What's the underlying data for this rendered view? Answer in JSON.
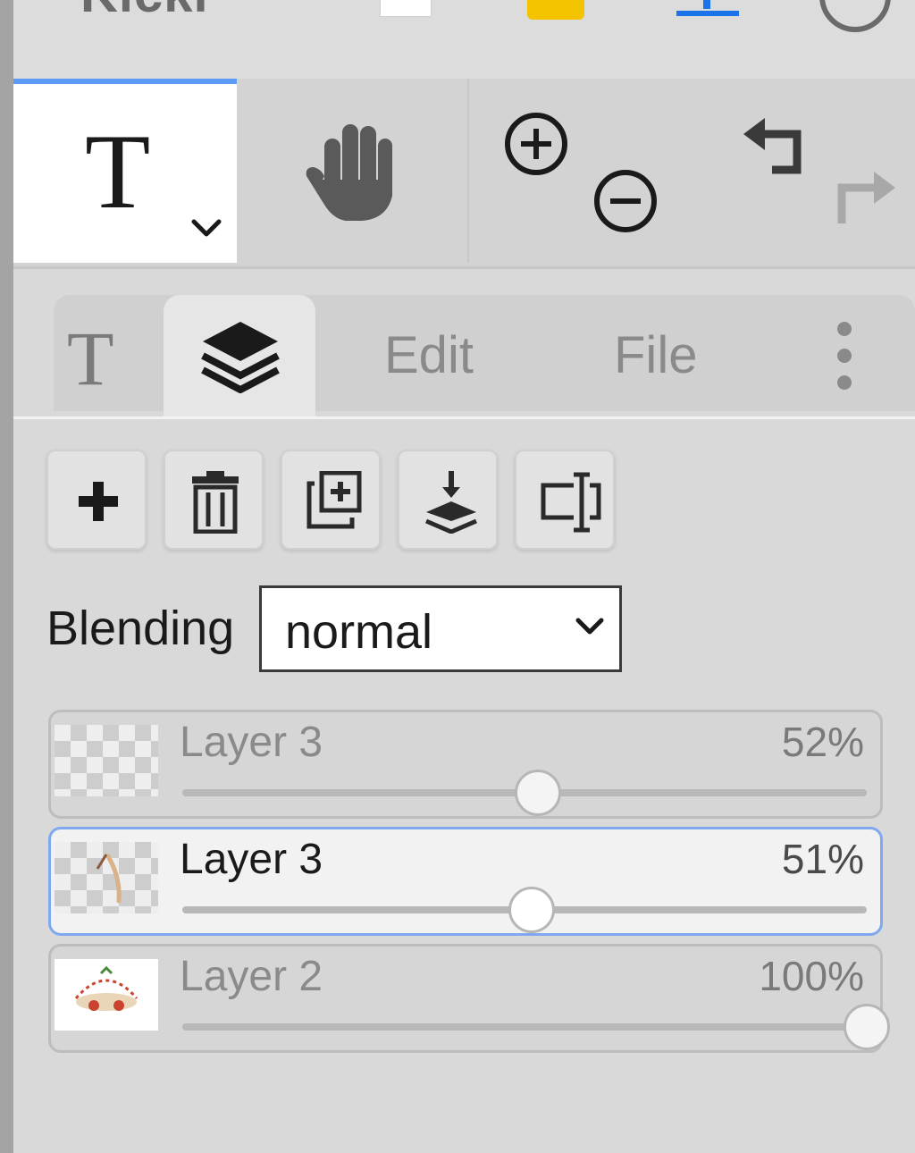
{
  "header": {
    "logo_fragment": "Kicki"
  },
  "toolbar": {
    "tools": [
      {
        "name": "text-tool",
        "glyph": "T",
        "active": true
      },
      {
        "name": "hand-tool"
      },
      {
        "name": "zoom-in"
      },
      {
        "name": "zoom-out"
      },
      {
        "name": "undo"
      },
      {
        "name": "redo"
      }
    ]
  },
  "tabs": {
    "text_glyph": "T",
    "active": "layers",
    "edit_label": "Edit",
    "file_label": "File"
  },
  "layer_actions": [
    "add-layer",
    "delete-layer",
    "duplicate-layer",
    "merge-down",
    "rename-layer"
  ],
  "blending": {
    "label": "Blending",
    "value": "normal"
  },
  "layers": [
    {
      "name": "Layer 3",
      "opacity_label": "52%",
      "opacity": 52,
      "selected": false
    },
    {
      "name": "Layer 3",
      "opacity_label": "51%",
      "opacity": 51,
      "selected": true
    },
    {
      "name": "Layer 2",
      "opacity_label": "100%",
      "opacity": 100,
      "selected": false
    }
  ],
  "colors": {
    "accent": "#5b9bf6",
    "selected_border": "#7fa9ef",
    "yellow": "#f5c400",
    "blue": "#1a73e8"
  }
}
